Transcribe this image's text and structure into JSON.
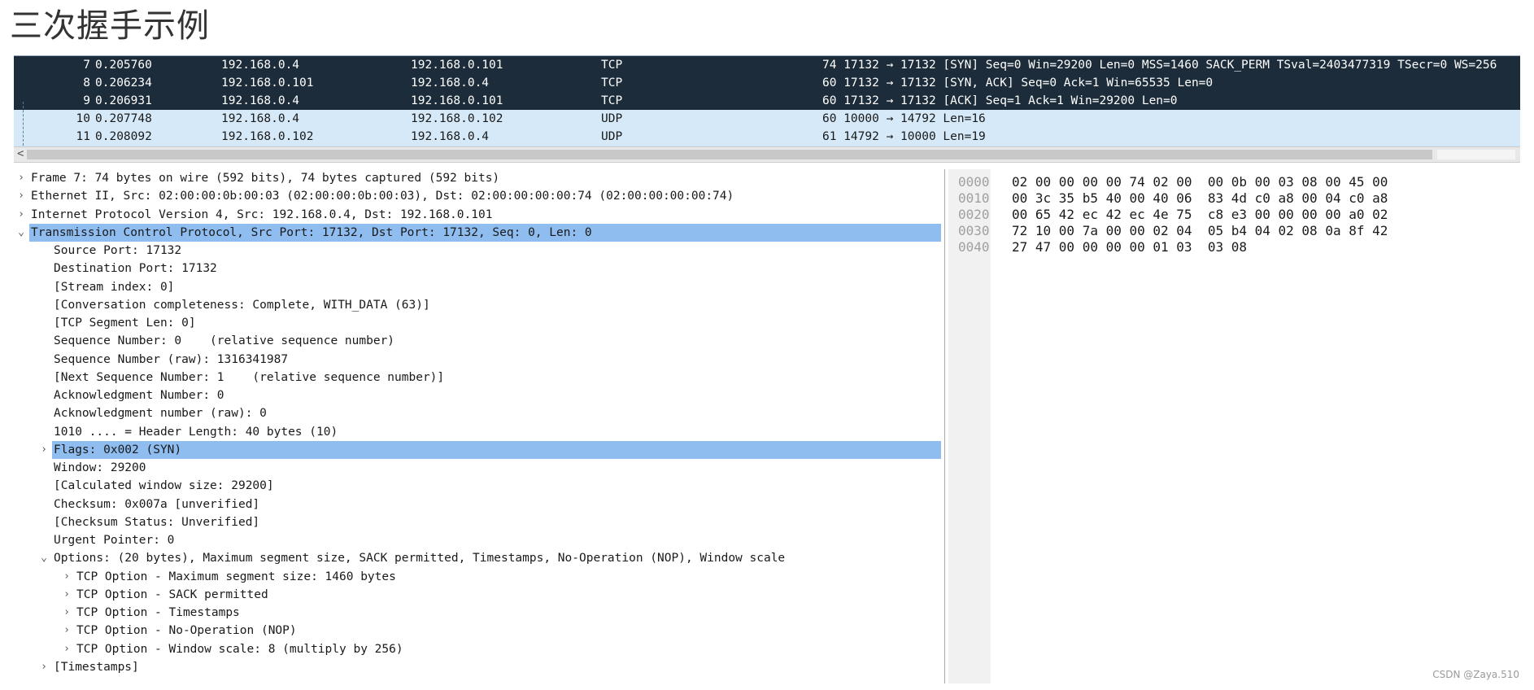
{
  "title": "三次握手示例",
  "packet_list": [
    {
      "no": "7",
      "time": "0.205760",
      "src": "192.168.0.4",
      "dst": "192.168.0.101",
      "proto": "TCP",
      "info": "74 17132 → 17132 [SYN] Seq=0 Win=29200 Len=0 MSS=1460 SACK_PERM TSval=2403477319 TSecr=0 WS=256",
      "selected": true
    },
    {
      "no": "8",
      "time": "0.206234",
      "src": "192.168.0.101",
      "dst": "192.168.0.4",
      "proto": "TCP",
      "info": "60 17132 → 17132 [SYN, ACK] Seq=0 Ack=1 Win=65535 Len=0",
      "selected": true
    },
    {
      "no": "9",
      "time": "0.206931",
      "src": "192.168.0.4",
      "dst": "192.168.0.101",
      "proto": "TCP",
      "info": "60 17132 → 17132 [ACK] Seq=1 Ack=1 Win=29200 Len=0",
      "selected": true
    },
    {
      "no": "10",
      "time": "0.207748",
      "src": "192.168.0.4",
      "dst": "192.168.0.102",
      "proto": "UDP",
      "info": "60 10000 → 14792 Len=16",
      "selected": false
    },
    {
      "no": "11",
      "time": "0.208092",
      "src": "192.168.0.102",
      "dst": "192.168.0.4",
      "proto": "UDP",
      "info": "61 14792 → 10000 Len=19",
      "selected": false
    }
  ],
  "scroll_left_glyph": "<",
  "details": [
    {
      "twisty": "›",
      "level": 0,
      "text": "Frame 7: 74 bytes on wire (592 bits), 74 bytes captured (592 bits)",
      "highlight": false
    },
    {
      "twisty": "›",
      "level": 0,
      "text": "Ethernet II, Src: 02:00:00:0b:00:03 (02:00:00:0b:00:03), Dst: 02:00:00:00:00:74 (02:00:00:00:00:74)",
      "highlight": false
    },
    {
      "twisty": "›",
      "level": 0,
      "text": "Internet Protocol Version 4, Src: 192.168.0.4, Dst: 192.168.0.101",
      "highlight": false
    },
    {
      "twisty": "⌄",
      "level": 0,
      "text": "Transmission Control Protocol, Src Port: 17132, Dst Port: 17132, Seq: 0, Len: 0",
      "highlight": true
    },
    {
      "twisty": "",
      "level": 1,
      "text": "Source Port: 17132",
      "highlight": false
    },
    {
      "twisty": "",
      "level": 1,
      "text": "Destination Port: 17132",
      "highlight": false
    },
    {
      "twisty": "",
      "level": 1,
      "text": "[Stream index: 0]",
      "highlight": false
    },
    {
      "twisty": "",
      "level": 1,
      "text": "[Conversation completeness: Complete, WITH_DATA (63)]",
      "highlight": false
    },
    {
      "twisty": "",
      "level": 1,
      "text": "[TCP Segment Len: 0]",
      "highlight": false
    },
    {
      "twisty": "",
      "level": 1,
      "text": "Sequence Number: 0    (relative sequence number)",
      "highlight": false
    },
    {
      "twisty": "",
      "level": 1,
      "text": "Sequence Number (raw): 1316341987",
      "highlight": false
    },
    {
      "twisty": "",
      "level": 1,
      "text": "[Next Sequence Number: 1    (relative sequence number)]",
      "highlight": false
    },
    {
      "twisty": "",
      "level": 1,
      "text": "Acknowledgment Number: 0",
      "highlight": false
    },
    {
      "twisty": "",
      "level": 1,
      "text": "Acknowledgment number (raw): 0",
      "highlight": false
    },
    {
      "twisty": "",
      "level": 1,
      "text": "1010 .... = Header Length: 40 bytes (10)",
      "highlight": false
    },
    {
      "twisty": "›",
      "level": 1,
      "text": "Flags: 0x002 (SYN)",
      "highlight": true
    },
    {
      "twisty": "",
      "level": 1,
      "text": "Window: 29200",
      "highlight": false
    },
    {
      "twisty": "",
      "level": 1,
      "text": "[Calculated window size: 29200]",
      "highlight": false
    },
    {
      "twisty": "",
      "level": 1,
      "text": "Checksum: 0x007a [unverified]",
      "highlight": false
    },
    {
      "twisty": "",
      "level": 1,
      "text": "[Checksum Status: Unverified]",
      "highlight": false
    },
    {
      "twisty": "",
      "level": 1,
      "text": "Urgent Pointer: 0",
      "highlight": false
    },
    {
      "twisty": "⌄",
      "level": 1,
      "text": "Options: (20 bytes), Maximum segment size, SACK permitted, Timestamps, No-Operation (NOP), Window scale",
      "highlight": false
    },
    {
      "twisty": "›",
      "level": 2,
      "text": "TCP Option - Maximum segment size: 1460 bytes",
      "highlight": false
    },
    {
      "twisty": "›",
      "level": 2,
      "text": "TCP Option - SACK permitted",
      "highlight": false
    },
    {
      "twisty": "›",
      "level": 2,
      "text": "TCP Option - Timestamps",
      "highlight": false
    },
    {
      "twisty": "›",
      "level": 2,
      "text": "TCP Option - No-Operation (NOP)",
      "highlight": false
    },
    {
      "twisty": "›",
      "level": 2,
      "text": "TCP Option - Window scale: 8 (multiply by 256)",
      "highlight": false
    },
    {
      "twisty": "›",
      "level": 1,
      "text": "[Timestamps]",
      "highlight": false
    }
  ],
  "bytes": [
    {
      "offset": "0000",
      "hex": "02 00 00 00 00 74 02 00  00 0b 00 03 08 00 45 00"
    },
    {
      "offset": "0010",
      "hex": "00 3c 35 b5 40 00 40 06  83 4d c0 a8 00 04 c0 a8"
    },
    {
      "offset": "0020",
      "hex": "00 65 42 ec 42 ec 4e 75  c8 e3 00 00 00 00 a0 02"
    },
    {
      "offset": "0030",
      "hex": "72 10 00 7a 00 00 02 04  05 b4 04 02 08 0a 8f 42"
    },
    {
      "offset": "0040",
      "hex": "27 47 00 00 00 00 01 03  03 08"
    }
  ],
  "watermark": "CSDN @Zaya.510",
  "colors": {
    "selected_row": "#1c2c3a",
    "normal_row": "#d6e9f8",
    "highlight": "#8fbdf0"
  }
}
